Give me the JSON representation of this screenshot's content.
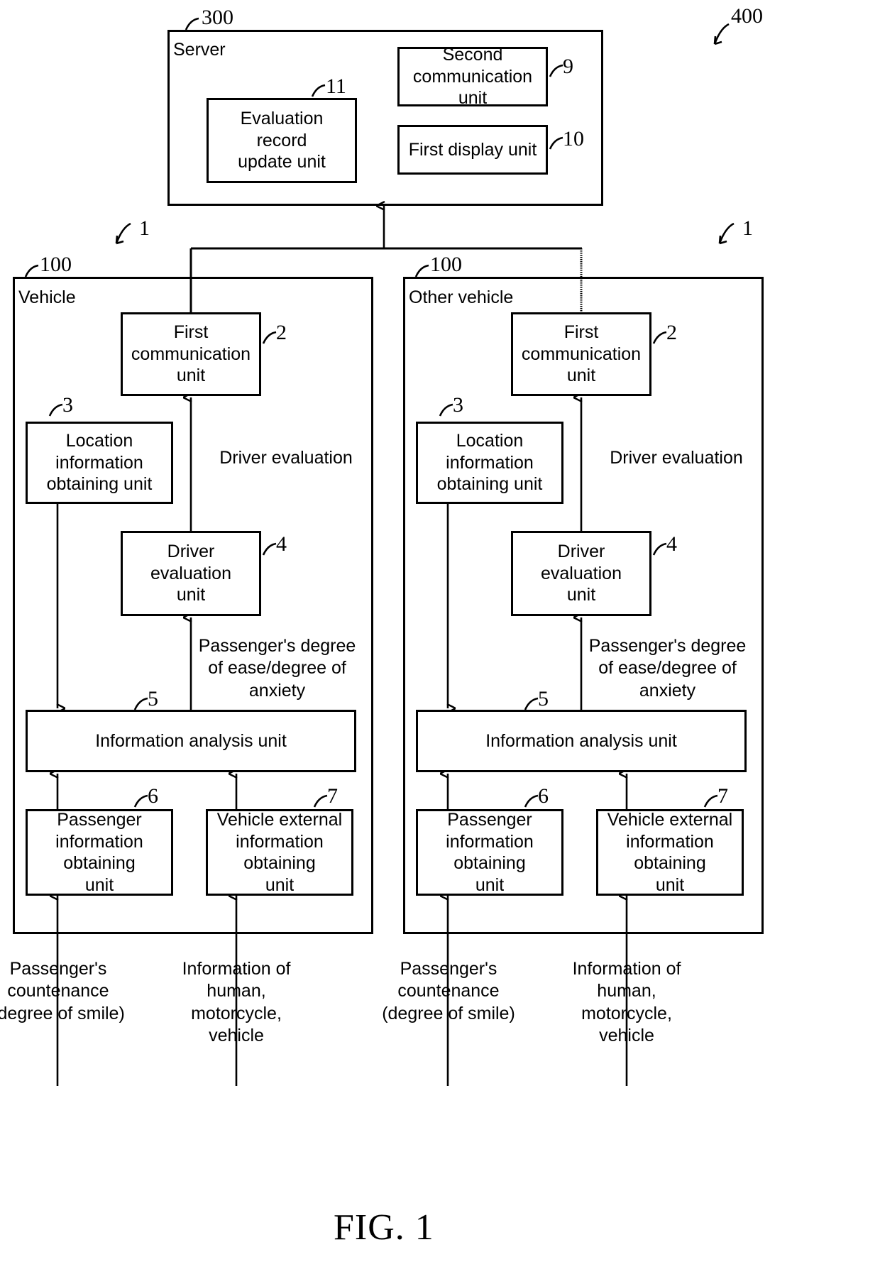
{
  "figure": {
    "caption": "FIG. 1",
    "system_ref": "400"
  },
  "server": {
    "label": "Server",
    "ref": "300",
    "units": [
      {
        "name": "Evaluation record\nupdate unit",
        "ref": "11"
      },
      {
        "name": "Second\ncommunication unit",
        "ref": "9"
      },
      {
        "name": "First display unit",
        "ref": "10"
      }
    ]
  },
  "vehicles": [
    {
      "label": "Vehicle",
      "ref": "100",
      "system_ref": "1",
      "units": [
        {
          "name": "First communication\nunit",
          "ref": "2"
        },
        {
          "name": "Location information\nobtaining unit",
          "ref": "3"
        },
        {
          "name": "Driver evaluation\nunit",
          "ref": "4"
        },
        {
          "name": "Information analysis unit",
          "ref": "5"
        },
        {
          "name": "Passenger\ninformation obtaining\nunit",
          "ref": "6"
        },
        {
          "name": "Vehicle external\ninformation obtaining\nunit",
          "ref": "7"
        }
      ],
      "flows": [
        {
          "text": "Driver evaluation"
        },
        {
          "text": "Passenger's degree\nof ease/degree of\nanxiety"
        }
      ],
      "inputs": [
        {
          "text": "Passenger's\ncountenance\n(degree of smile)"
        },
        {
          "text": "Information of\nhuman, motorcycle,\nvehicle"
        }
      ]
    },
    {
      "label": "Other vehicle",
      "ref": "100",
      "system_ref": "1",
      "units": [
        {
          "name": "First communication\nunit",
          "ref": "2"
        },
        {
          "name": "Location information\nobtaining unit",
          "ref": "3"
        },
        {
          "name": "Driver evaluation\nunit",
          "ref": "4"
        },
        {
          "name": "Information analysis unit",
          "ref": "5"
        },
        {
          "name": "Passenger\ninformation obtaining\nunit",
          "ref": "6"
        },
        {
          "name": "Vehicle external\ninformation obtaining\nunit",
          "ref": "7"
        }
      ],
      "flows": [
        {
          "text": "Driver evaluation"
        },
        {
          "text": "Passenger's degree\nof ease/degree of\nanxiety"
        }
      ],
      "inputs": [
        {
          "text": "Passenger's\ncountenance\n(degree of smile)"
        },
        {
          "text": "Information of\nhuman, motorcycle,\nvehicle"
        }
      ]
    }
  ]
}
